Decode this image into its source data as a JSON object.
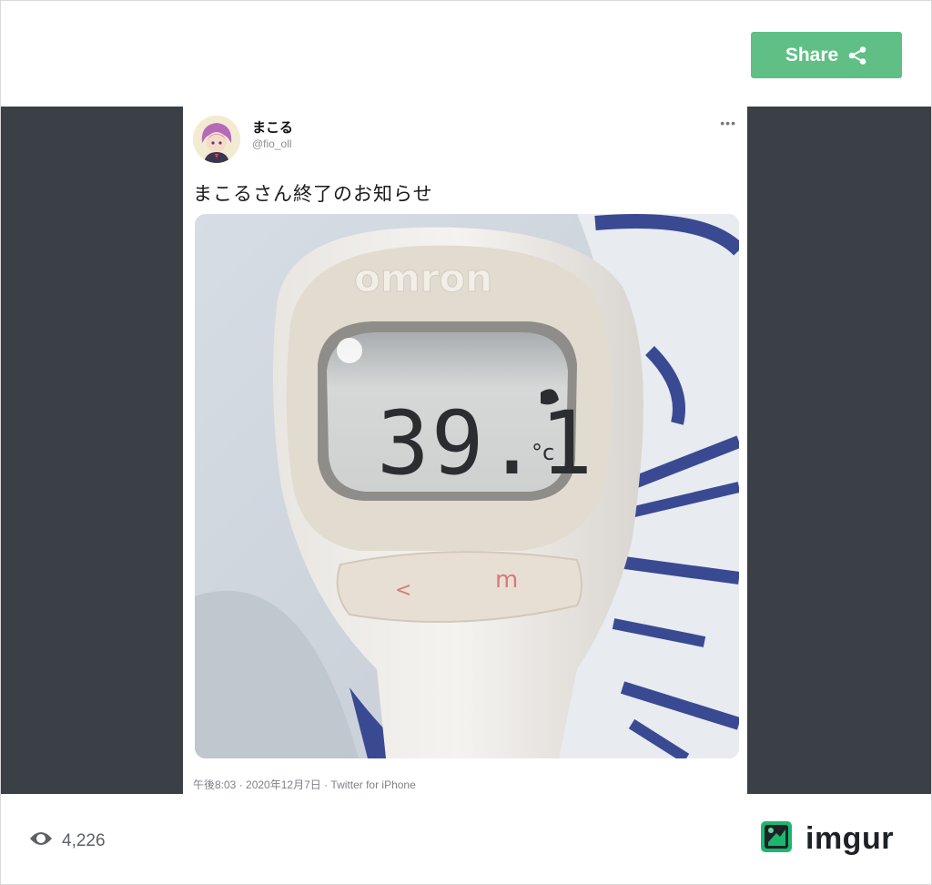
{
  "toolbar": {
    "share_label": "Share"
  },
  "tweet": {
    "name": "まこる",
    "handle": "@fio_oll",
    "more": "•••",
    "text": "まこるさん終了のお知らせ",
    "meta": "午後8:03 · 2020年12月7日 · Twitter for iPhone",
    "photo": {
      "brand": "omron",
      "reading": "39.1",
      "unit": "°c",
      "buttons": [
        "<",
        "m"
      ]
    }
  },
  "footer": {
    "views": "4,226",
    "logo": "imgur",
    "icons": {
      "views": "eye-icon",
      "logo": "imgur-logo-icon",
      "share": "share-icon"
    }
  },
  "colors": {
    "share": "#5fbf85",
    "band": "#3b3f46",
    "logo": "#1bb76e"
  }
}
